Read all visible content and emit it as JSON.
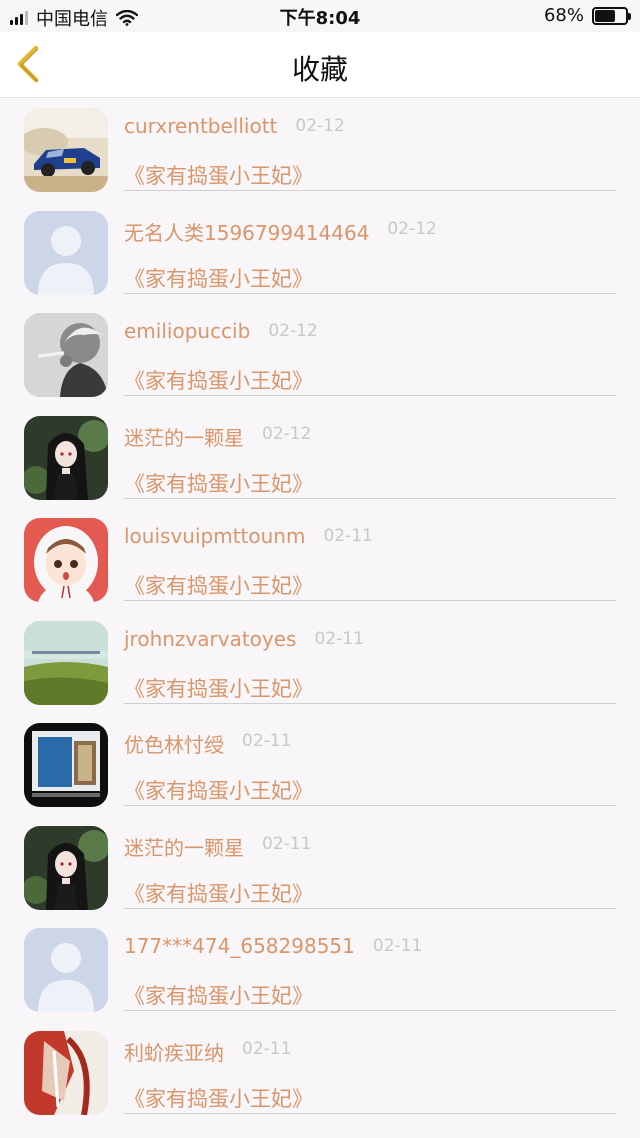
{
  "status_bar": {
    "carrier": "中国电信",
    "time": "下午8:04",
    "battery_text": "68%",
    "battery_level": 0.68,
    "icons": [
      "signal-icon",
      "wifi-icon",
      "battery-icon"
    ]
  },
  "nav": {
    "title": "收藏",
    "back_icon": "chevron-left-icon",
    "accent_color": "#e3b72c"
  },
  "colors": {
    "username": "#d9966a",
    "book": "#d9966a",
    "date": "#c8c8c8"
  },
  "items": [
    {
      "user": "curxrentbelliott",
      "date": "02-12",
      "book": "《家有捣蛋小王妃》",
      "avatar": "rally-car"
    },
    {
      "user": "无名人类1596799414464",
      "date": "02-12",
      "book": "《家有捣蛋小王妃》",
      "avatar": "default-person"
    },
    {
      "user": "emiliopuccib",
      "date": "02-12",
      "book": "《家有捣蛋小王妃》",
      "avatar": "smoking-man"
    },
    {
      "user": "迷茫的一颗星",
      "date": "02-12",
      "book": "《家有捣蛋小王妃》",
      "avatar": "anime-girl-dark"
    },
    {
      "user": "louisvuipmttounm",
      "date": "02-11",
      "book": "《家有捣蛋小王妃》",
      "avatar": "anime-girl-hood"
    },
    {
      "user": "jrohnzvarvatoyes",
      "date": "02-11",
      "book": "《家有捣蛋小王妃》",
      "avatar": "green-field"
    },
    {
      "user": "优色林忖绶",
      "date": "02-11",
      "book": "《家有捣蛋小王妃》",
      "avatar": "window-photo"
    },
    {
      "user": "迷茫的一颗星",
      "date": "02-11",
      "book": "《家有捣蛋小王妃》",
      "avatar": "anime-girl-dark"
    },
    {
      "user": "177***474_658298551",
      "date": "02-11",
      "book": "《家有捣蛋小王妃》",
      "avatar": "default-person"
    },
    {
      "user": "利蚧疾亚纳",
      "date": "02-11",
      "book": "《家有捣蛋小王妃》",
      "avatar": "red-art"
    }
  ]
}
